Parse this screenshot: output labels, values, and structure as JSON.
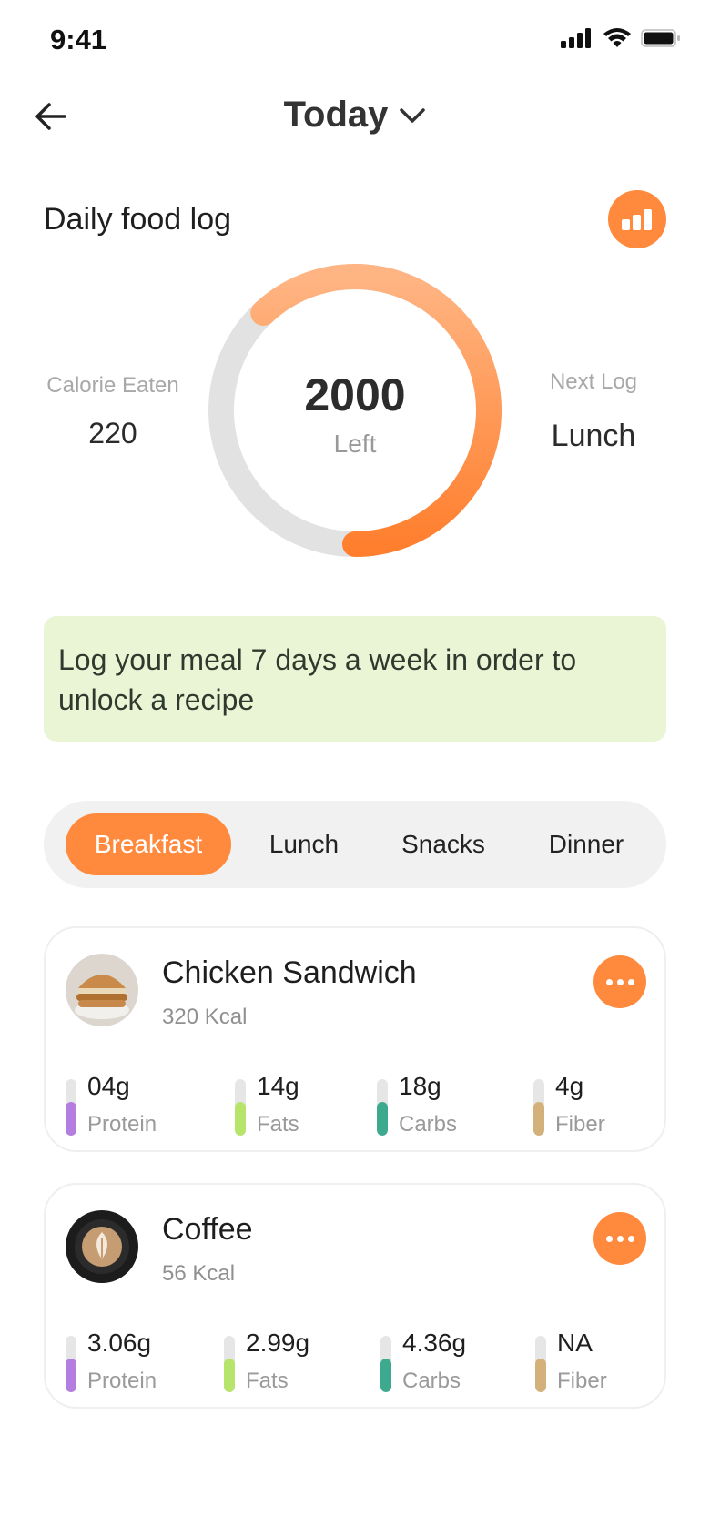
{
  "status_bar": {
    "time": "9:41"
  },
  "header": {
    "title": "Today"
  },
  "section": {
    "title": "Daily food log"
  },
  "summary": {
    "ring_value": "2000",
    "ring_label": "Left",
    "ring_progress": 0.62,
    "calorie_label": "Calorie Eaten",
    "calorie_value": "220",
    "next_label": "Next Log",
    "next_value": "Lunch"
  },
  "banner": {
    "text": "Log your meal 7 days a week in order to unlock  a recipe"
  },
  "tabs": [
    {
      "label": "Breakfast",
      "active": true
    },
    {
      "label": "Lunch",
      "active": false
    },
    {
      "label": "Snacks",
      "active": false
    },
    {
      "label": "Dinner",
      "active": false
    }
  ],
  "meals": [
    {
      "name": "Chicken Sandwich",
      "kcal": "320 Kcal",
      "image": "burger-image",
      "macros": [
        {
          "value": "04g",
          "label": "Protein",
          "color": "#b47de0",
          "level": 0.6
        },
        {
          "value": "14g",
          "label": "Fats",
          "color": "#b7e46a",
          "level": 0.6
        },
        {
          "value": "18g",
          "label": "Carbs",
          "color": "#3daa8f",
          "level": 0.6
        },
        {
          "value": "4g",
          "label": "Fiber",
          "color": "#d4b07a",
          "level": 0.6
        }
      ]
    },
    {
      "name": "Coffee",
      "kcal": "56 Kcal",
      "image": "latte-image",
      "macros": [
        {
          "value": "3.06g",
          "label": "Protein",
          "color": "#b47de0",
          "level": 0.6
        },
        {
          "value": "2.99g",
          "label": "Fats",
          "color": "#b7e46a",
          "level": 0.6
        },
        {
          "value": "4.36g",
          "label": "Carbs",
          "color": "#3daa8f",
          "level": 0.6
        },
        {
          "value": "NA",
          "label": "Fiber",
          "color": "#d4b07a",
          "level": 0.6
        }
      ]
    }
  ],
  "colors": {
    "accent": "#ff8a3d",
    "accent_light": "#ffb07e",
    "track": "#e2e2e2",
    "banner_bg": "#eaf5d6"
  }
}
